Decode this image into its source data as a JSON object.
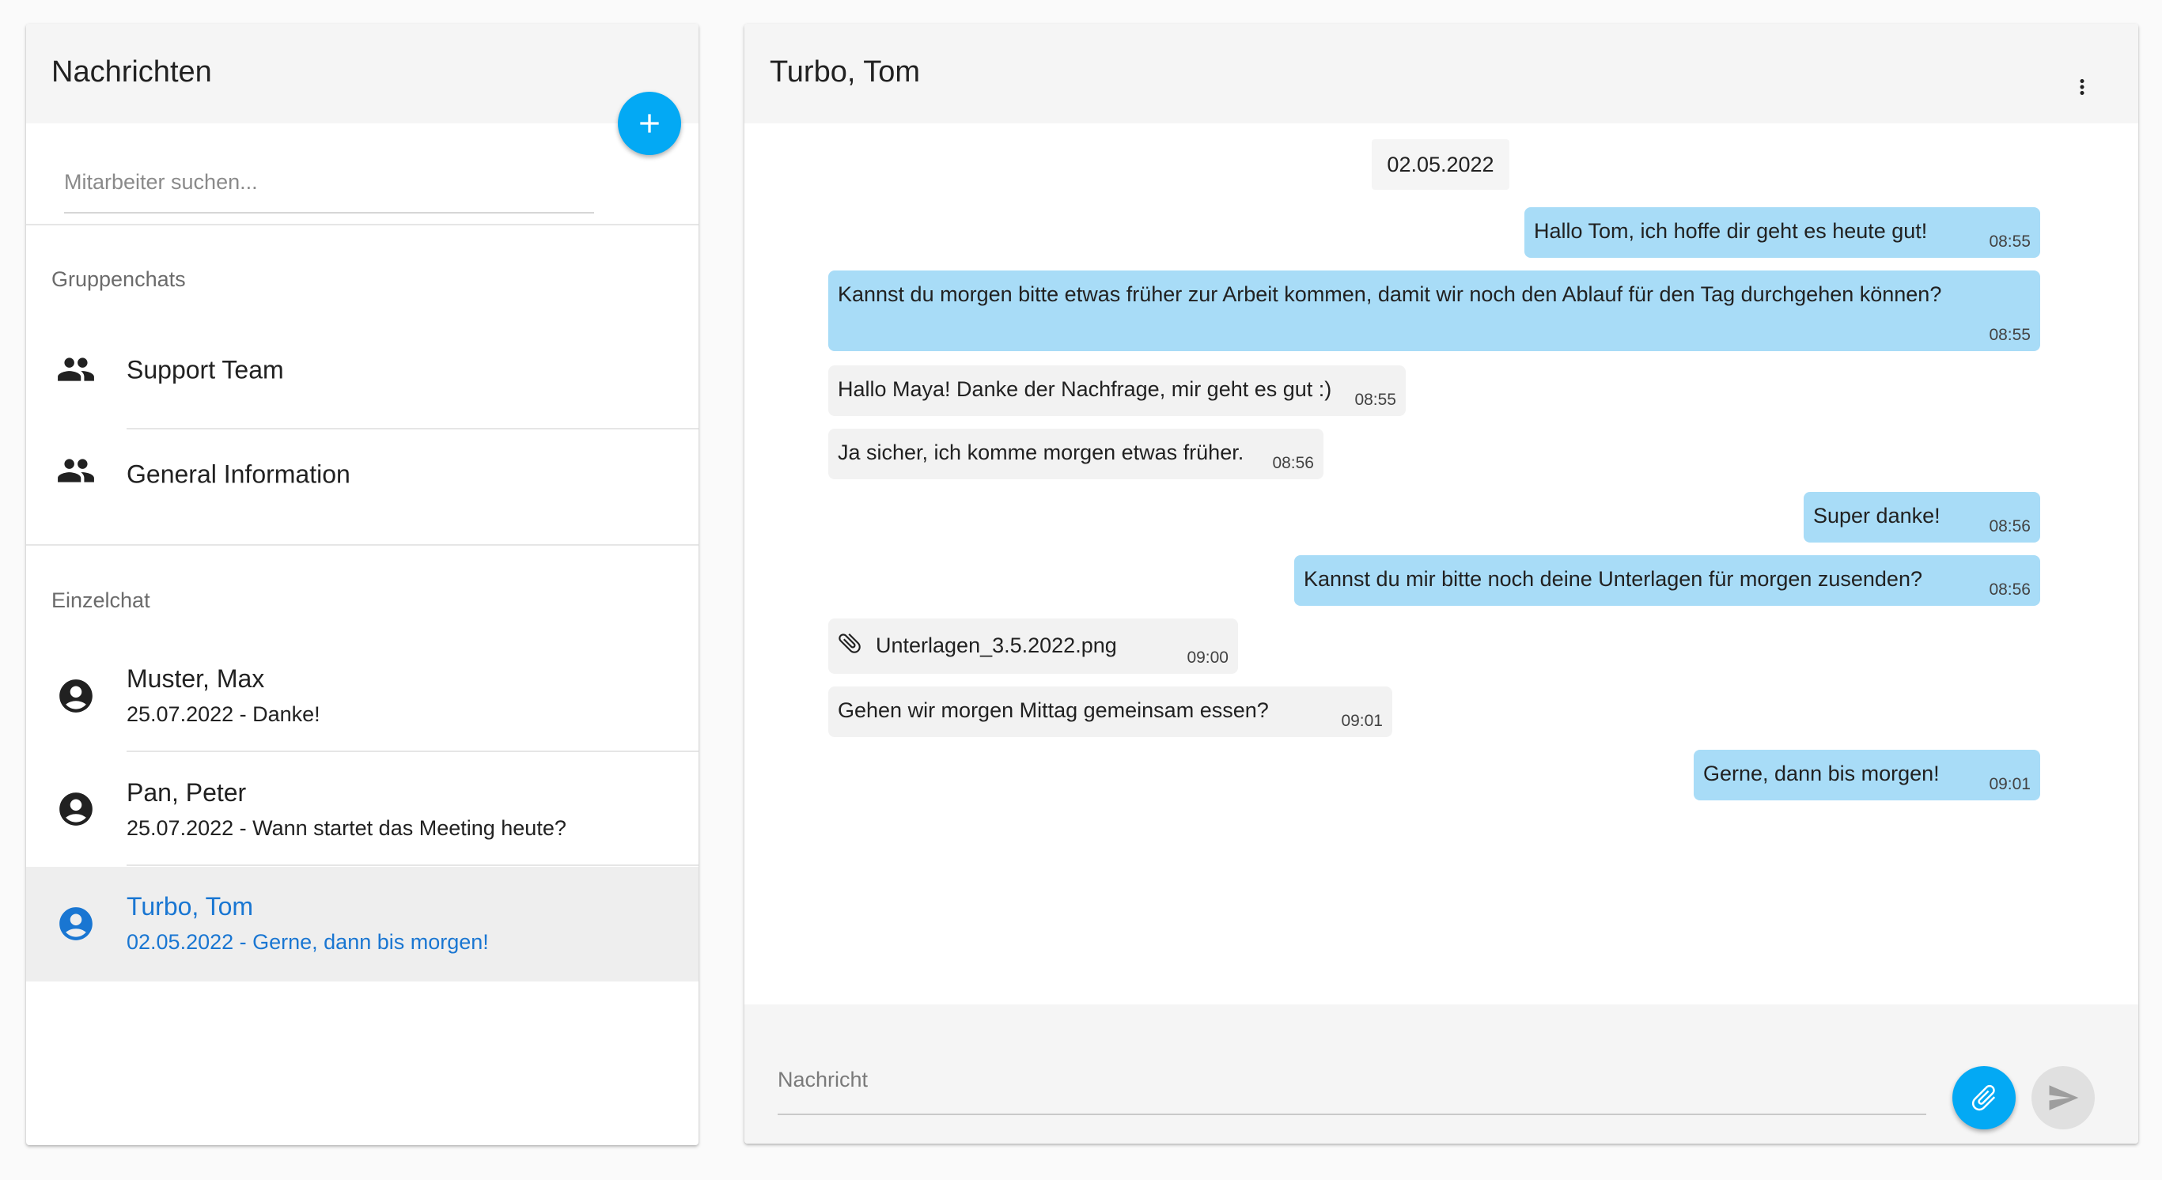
{
  "sidebar": {
    "title": "Nachrichten",
    "search_placeholder": "Mitarbeiter suchen...",
    "group_section_label": "Gruppenchats",
    "groups": [
      {
        "name": "Support Team",
        "icon": "group-icon"
      },
      {
        "name": "General Information",
        "icon": "group-icon"
      }
    ],
    "single_section_label": "Einzelchat",
    "contacts": [
      {
        "name": "Muster, Max",
        "preview": "25.07.2022 - Danke!",
        "icon": "account-circle-icon",
        "active": false
      },
      {
        "name": "Pan, Peter",
        "preview": "25.07.2022 - Wann startet das Meeting heute?",
        "icon": "account-circle-icon",
        "active": false
      },
      {
        "name": "Turbo, Tom",
        "preview": "02.05.2022 - Gerne, dann bis morgen!",
        "icon": "account-circle-icon",
        "active": true
      }
    ]
  },
  "chat": {
    "title": "Turbo, Tom",
    "date": "02.05.2022",
    "messages": [
      {
        "text": "Hallo Tom, ich hoffe dir geht es heute gut!",
        "time": "08:55",
        "direction": "outgoing"
      },
      {
        "text": "Kannst du morgen bitte etwas früher zur Arbeit kommen, damit wir noch den Ablauf für den Tag durchgehen können?",
        "time": "08:55",
        "direction": "outgoing"
      },
      {
        "text": "Hallo Maya! Danke der Nachfrage, mir geht es gut :)",
        "time": "08:55",
        "direction": "incoming"
      },
      {
        "text": "Ja sicher, ich komme morgen etwas früher.",
        "time": "08:56",
        "direction": "incoming"
      },
      {
        "text": "Super danke!",
        "time": "08:56",
        "direction": "outgoing"
      },
      {
        "text": "Kannst du mir bitte noch deine Unterlagen für morgen zusenden?",
        "time": "08:56",
        "direction": "outgoing"
      },
      {
        "text": "Unterlagen_3.5.2022.png",
        "time": "09:00",
        "direction": "incoming",
        "attachment": true
      },
      {
        "text": "Gehen wir morgen Mittag gemeinsam essen?",
        "time": "09:01",
        "direction": "incoming"
      },
      {
        "text": "Gerne, dann bis morgen!",
        "time": "09:01",
        "direction": "outgoing"
      }
    ],
    "composer_placeholder": "Nachricht"
  },
  "colors": {
    "accent": "#03a9f4",
    "active_text": "#1976d2",
    "outgoing_bubble": "#a8dcf7",
    "incoming_bubble": "#f2f2f2",
    "header_bg": "#f5f5f5"
  }
}
